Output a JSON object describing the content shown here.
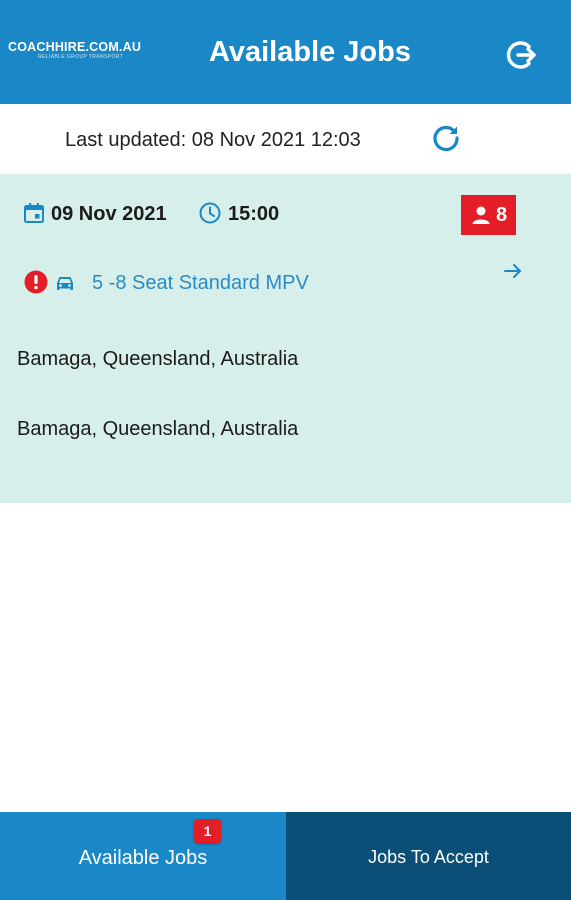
{
  "header": {
    "logo_text": "COACHHIRE.COM.AU",
    "logo_tagline": "RELIABLE GROUP TRANSPORT",
    "title": "Available Jobs",
    "logout_icon": "logout-icon"
  },
  "status": {
    "last_updated": "Last updated: 08 Nov 2021 12:03",
    "refresh_icon": "refresh-icon"
  },
  "jobs": [
    {
      "date": "09 Nov 2021",
      "time": "15:00",
      "passengers": "8",
      "vehicle": "5 -8 Seat Standard MPV",
      "pickup": "Bamaga, Queensland, Australia",
      "dropoff": "Bamaga, Queensland, Australia"
    }
  ],
  "tabs": {
    "available_label": "Available Jobs",
    "available_count": "1",
    "accept_label": "Jobs To Accept"
  },
  "colors": {
    "primary": "#1a87c6",
    "dark_tab": "#0b4f78",
    "card_bg": "#d7efea",
    "alert": "#e31e26",
    "link": "#2a8ac6"
  }
}
